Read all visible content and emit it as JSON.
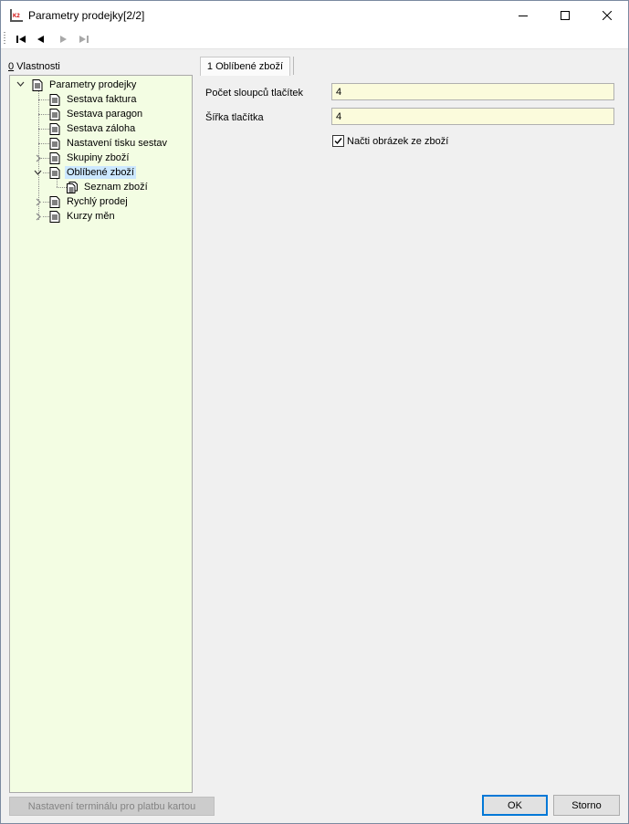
{
  "window": {
    "title": "Parametry prodejky[2/2]",
    "app_icon_text": "K2"
  },
  "toolbar": {
    "buttons": [
      "first-record",
      "previous-record",
      "next-record",
      "last-record"
    ]
  },
  "left_panel": {
    "label_accel": "0",
    "label_rest": " Vlastnosti",
    "tree": {
      "root": "Parametry prodejky",
      "items": [
        "Sestava faktura",
        "Sestava paragon",
        "Sestava záloha",
        "Nastavení tisku sestav",
        "Skupiny zboží",
        "Oblíbené zboží",
        "Seznam zboží",
        "Rychlý prodej",
        "Kurzy měn"
      ],
      "selected": "Oblíbené zboží"
    }
  },
  "tabs": {
    "active": "1 Oblíbené zboží"
  },
  "form": {
    "columns_label": "Počet sloupců tlačítek",
    "columns_value": "4",
    "width_label": "Šířka tlačítka",
    "width_value": "4",
    "load_image_label": "Načti obrázek ze zboží",
    "load_image_checked": true
  },
  "footer": {
    "terminal_button": "Nastavení terminálu pro platbu kartou",
    "ok_button": "OK",
    "cancel_button": "Storno"
  },
  "colors": {
    "tree_background": "#f3fde3",
    "input_background": "#fbfbdc",
    "selection": "#cce8ff",
    "default_button_border": "#0078d7"
  }
}
